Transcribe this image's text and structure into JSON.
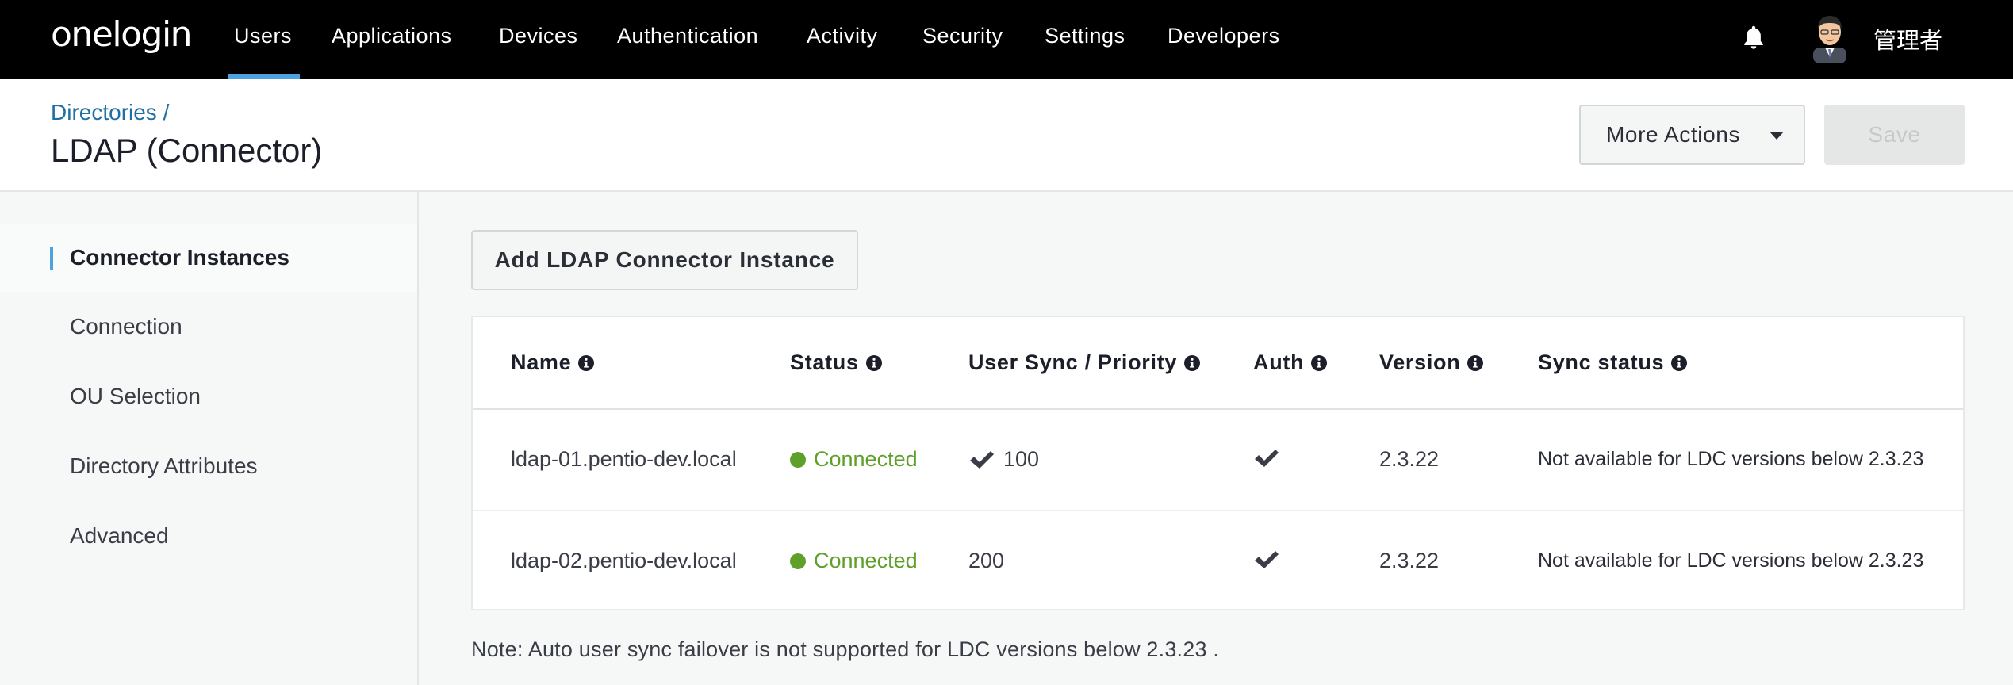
{
  "brand": {
    "logo_text": "onelogin"
  },
  "nav": {
    "items": [
      "Users",
      "Applications",
      "Devices",
      "Authentication",
      "Activity",
      "Security",
      "Settings",
      "Developers"
    ],
    "active": "Users",
    "user_name": "管理者"
  },
  "header": {
    "breadcrumb": "Directories /",
    "title": "LDAP (Connector)",
    "more_actions_label": "More Actions",
    "save_label": "Save"
  },
  "sidebar": {
    "items": [
      "Connector Instances",
      "Connection",
      "OU Selection",
      "Directory Attributes",
      "Advanced"
    ],
    "active": "Connector Instances"
  },
  "main": {
    "add_button_label": "Add LDAP Connector Instance",
    "table": {
      "columns": [
        "Name",
        "Status",
        "User Sync / Priority",
        "Auth",
        "Version",
        "Sync status"
      ],
      "rows": [
        {
          "name": "ldap-01.pentio-dev.local",
          "status": "Connected",
          "user_sync_checked": true,
          "priority": "100",
          "auth": true,
          "version": "2.3.22",
          "sync_status": "Not available for LDC versions below 2.3.23"
        },
        {
          "name": "ldap-02.pentio-dev.local",
          "status": "Connected",
          "user_sync_checked": false,
          "priority": "200",
          "auth": true,
          "version": "2.3.22",
          "sync_status": "Not available for LDC versions below 2.3.23"
        }
      ]
    },
    "note": "Note: Auto user sync failover is not supported for LDC versions below 2.3.23 ."
  },
  "colors": {
    "nav_bg": "#000000",
    "accent": "#4ea2e0",
    "link": "#1f6ea5",
    "connected": "#5fa02a"
  }
}
